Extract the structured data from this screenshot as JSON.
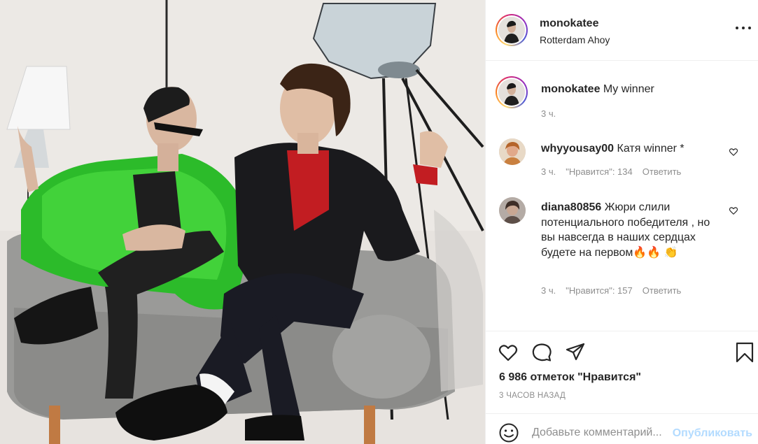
{
  "post": {
    "author": {
      "username": "monokatee",
      "location": "Rotterdam Ahoy"
    },
    "caption": {
      "username": "monokatee",
      "text": "My winner",
      "time": "3 ч."
    },
    "comments": [
      {
        "username": "whyyousay00",
        "text": "Катя winner *",
        "time": "3 ч.",
        "likes": "\"Нравится\": 134",
        "reply": "Ответить",
        "avatar_color": "#c9803f"
      },
      {
        "username": "diana80856",
        "text": "Жюри слили потенциального победителя , но вы навсегда в наших сердцах будете на первом🔥🔥 👏",
        "time": "3 ч.",
        "likes": "\"Нравится\": 157",
        "reply": "Ответить",
        "avatar_color": "#8a7d75"
      }
    ],
    "likes_label": "6 986 отметок \"Нравится\"",
    "time_ago": "3 ЧАСОВ НАЗАД",
    "comment_box": {
      "placeholder": "Добавьте комментарий...",
      "publish_label": "Опубликовать",
      "emoji_icon": "smile-icon"
    }
  },
  "icons": {
    "like": "heart-icon",
    "comment": "comment-bubble-icon",
    "share": "paper-plane-icon",
    "save": "bookmark-icon",
    "more": "more-horizontal-icon"
  },
  "colors": {
    "text": "#262626",
    "muted": "#8e8e8e",
    "publish_disabled": "#b3dbff",
    "border": "#efefef"
  }
}
